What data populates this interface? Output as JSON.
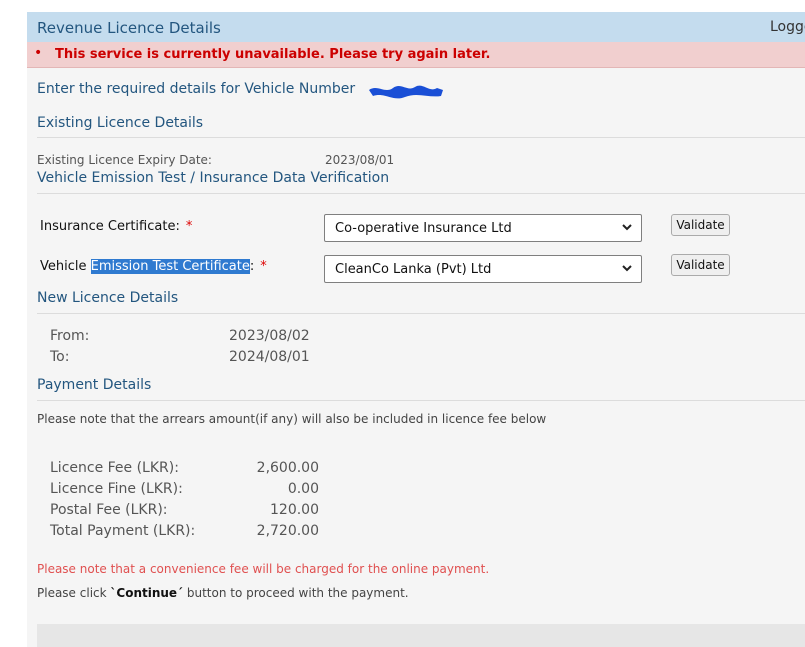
{
  "header": {
    "title": "Revenue Licence Details",
    "logged": "Logge"
  },
  "error": {
    "bullet": "•",
    "message": "This service is currently unavailable. Please try again later."
  },
  "intro": "Enter the required details for Vehicle Number",
  "existing": {
    "heading": "Existing Licence Details",
    "expiry_label": "Existing Licence Expiry Date:",
    "expiry_value": "2023/08/01"
  },
  "verification": {
    "heading": "Vehicle Emission Test / Insurance Data Verification",
    "insurance": {
      "label": "Insurance Certificate:",
      "required": "*",
      "selected": "Co-operative Insurance Ltd",
      "button": "Validate"
    },
    "emission": {
      "label_prefix": "Vehicle ",
      "label_highlight": "Emission Test Certificate",
      "label_suffix": ":",
      "required": "*",
      "selected": "CleanCo Lanka (Pvt) Ltd",
      "button": "Validate"
    }
  },
  "new_licence": {
    "heading": "New Licence Details",
    "from_label": "From:",
    "from_value": "2023/08/02",
    "to_label": "To:",
    "to_value": "2024/08/01"
  },
  "payment": {
    "heading": "Payment Details",
    "arrears_note": "Please note that the arrears amount(if any) will also be included in licence fee below",
    "rows": [
      {
        "label": "Licence Fee (LKR):",
        "value": "2,600.00"
      },
      {
        "label": "Licence Fine (LKR):",
        "value": "0.00"
      },
      {
        "label": "Postal Fee (LKR):",
        "value": "120.00"
      },
      {
        "label": "Total Payment (LKR):",
        "value": "2,720.00"
      }
    ],
    "convenience_note": "Please note that a convenience fee will be charged for the online payment.",
    "continue_prefix": "Please click ",
    "continue_word": "`Continue´",
    "continue_suffix": " button to proceed with the payment."
  },
  "colors": {
    "header_bg": "#c4dcee",
    "heading_text": "#23567f",
    "error_bg": "#f1cfcf",
    "error_text": "#cc0000",
    "highlight": "#2f7ad0",
    "scribble": "#1a4fd6"
  }
}
